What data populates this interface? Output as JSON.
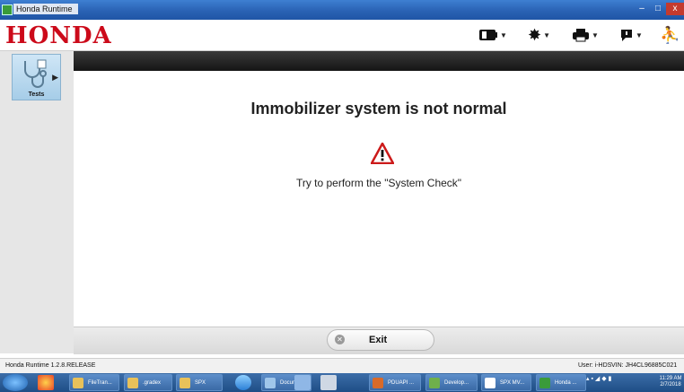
{
  "window": {
    "title": "Honda Runtime",
    "minimize_glyph": "–",
    "maximize_glyph": "□",
    "close_glyph": "x"
  },
  "header": {
    "logo": "HONDA",
    "toolbar": [
      {
        "icon": "battery-icon"
      },
      {
        "icon": "gear-icon"
      },
      {
        "icon": "printer-icon"
      },
      {
        "icon": "help-icon"
      },
      {
        "icon": "exit-run-icon"
      }
    ]
  },
  "sidebar": {
    "tests_tile": {
      "label": "Tests",
      "icon": "stethoscope-icon"
    }
  },
  "main": {
    "title": "Immobilizer system is not normal",
    "warning_icon": "warning-triangle-icon",
    "message": "Try to perform the \"System Check\""
  },
  "footer": {
    "exit_label": "Exit"
  },
  "statusbar": {
    "version": "Honda Runtime 1.2.8.RELEASE",
    "user": "User: i-HDS",
    "vin": "VIN: JH4CL96885C021"
  },
  "taskbar": {
    "items": [
      {
        "label": "FileTran...",
        "color": "#e8c15a"
      },
      {
        "label": ".gradex",
        "color": "#e8c15a"
      },
      {
        "label": "SPX",
        "color": "#e8c15a"
      },
      {
        "label": "Docume...",
        "color": "#9fc6ea"
      },
      {
        "label": "PDUAPI ...",
        "color": "#d86a2a"
      },
      {
        "label": "Develop...",
        "color": "#6fb04b"
      },
      {
        "label": "SPX MV...",
        "color": "#ffffff"
      },
      {
        "label": "Honda ...",
        "color": "#3a9b3a"
      }
    ],
    "clock_time": "11:29 AM",
    "clock_date": "2/7/2018"
  },
  "colors": {
    "brand_red": "#cc0a1a",
    "warning_red": "#cc1a1a",
    "taskbar_blue": "#2a5c99"
  }
}
